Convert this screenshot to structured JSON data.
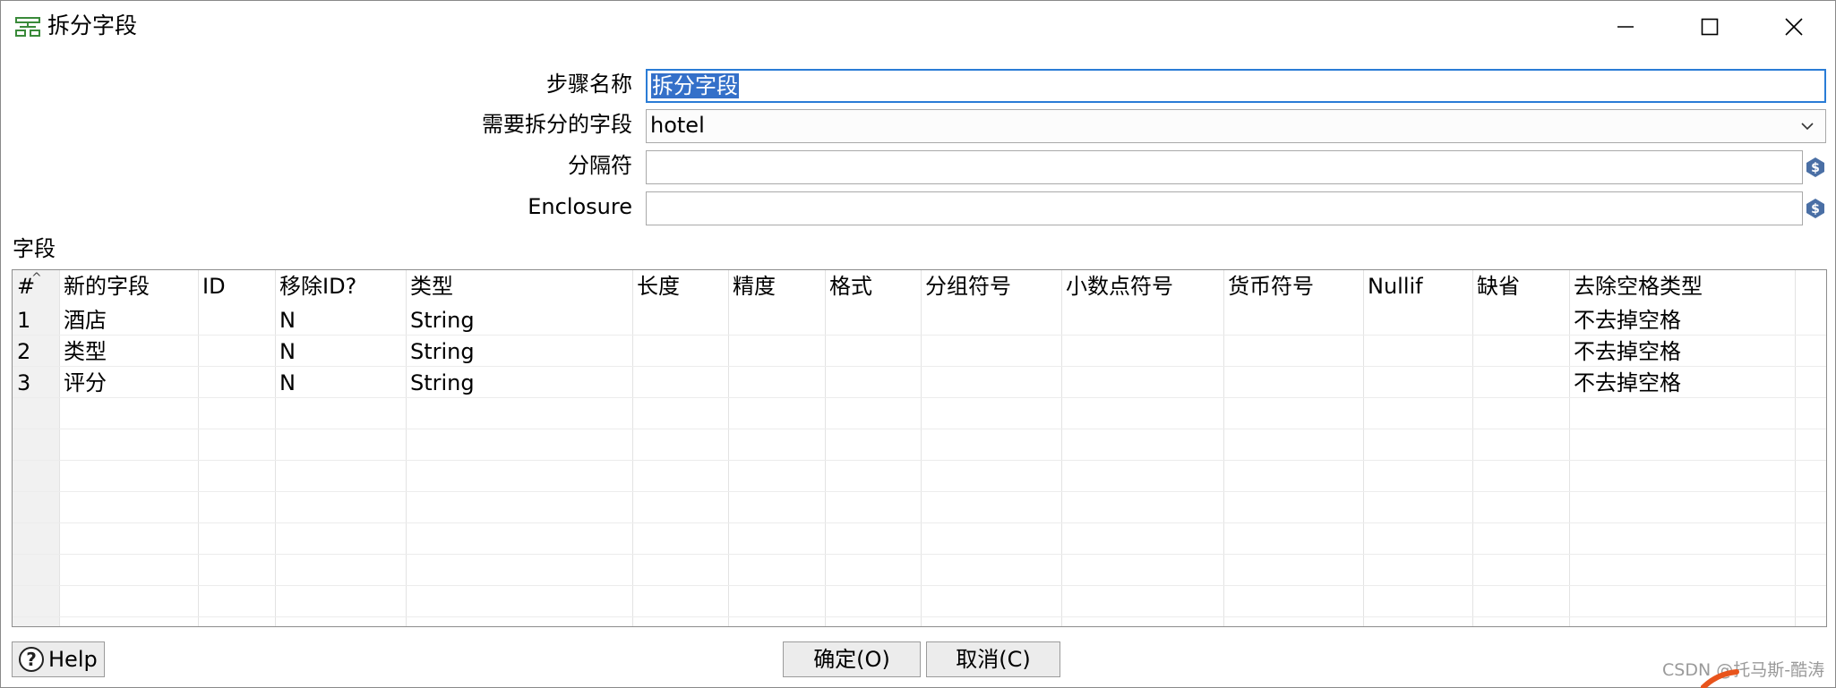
{
  "window": {
    "title": "拆分字段",
    "app_icon": "split-field-icon"
  },
  "form": {
    "step_name_label": "步骤名称",
    "step_name_value": "拆分字段",
    "field_to_split_label": "需要拆分的字段",
    "field_to_split_value": "hotel",
    "delimiter_label": "分隔符",
    "delimiter_value": "",
    "enclosure_label": "Enclosure",
    "enclosure_value": ""
  },
  "fields_section_label": "字段",
  "table": {
    "columns": [
      "#",
      "新的字段",
      "ID",
      "移除ID?",
      "类型",
      "长度",
      "精度",
      "格式",
      "分组符号",
      "小数点符号",
      "货币符号",
      "Nullif",
      "缺省",
      "去除空格类型"
    ],
    "rows": [
      [
        "1",
        "酒店",
        "",
        "N",
        "String",
        "",
        "",
        "",
        "",
        "",
        "",
        "",
        "",
        "不去掉空格"
      ],
      [
        "2",
        "类型",
        "",
        "N",
        "String",
        "",
        "",
        "",
        "",
        "",
        "",
        "",
        "",
        "不去掉空格"
      ],
      [
        "3",
        "评分",
        "",
        "N",
        "String",
        "",
        "",
        "",
        "",
        "",
        "",
        "",
        "",
        "不去掉空格"
      ]
    ]
  },
  "buttons": {
    "help": "Help",
    "ok": "确定(O)",
    "cancel": "取消(C)"
  },
  "watermark": "CSDN @托马斯-酷涛",
  "colors": {
    "selection": "#3470c9",
    "focus_border": "#2a7cd6",
    "variable_icon": "#4a6fa5"
  }
}
